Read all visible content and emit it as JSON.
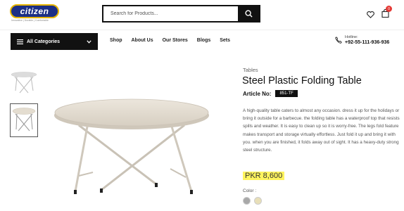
{
  "brand": {
    "logo_text": "citizen",
    "tagline": "Innovative | Durable | Comfortable"
  },
  "search": {
    "placeholder": "Search for Products..."
  },
  "header": {
    "cart_count": "0"
  },
  "nav": {
    "categories_label": "All Categories",
    "links": [
      "Shop",
      "About Us",
      "Our Stores",
      "Blogs",
      "Sets"
    ]
  },
  "hotline": {
    "label": "Hotline:",
    "number": "+92-55-111-936-936"
  },
  "product": {
    "breadcrumb": "Tables",
    "title": "Steel Plastic Folding Table",
    "article_label": "Article No:",
    "article_no": "851-TF",
    "description": "A high-quality table caters to almost any occasion. dress it up for the holidays or bring it outside for a barbecue. the folding table has a waterproof top that resists spills and weather. It is easy to clean up so it is worry-free. The legs fold feature makes transport and storage virtually effortless. Just fold it up and bring it with you. when you are finished, it folds away out of sight. It has a heavy-duty strong steel structure.",
    "price": "PKR 8,600",
    "color_label": "Color :",
    "colors": [
      "#a8a8a8",
      "#e8dfb8"
    ]
  }
}
